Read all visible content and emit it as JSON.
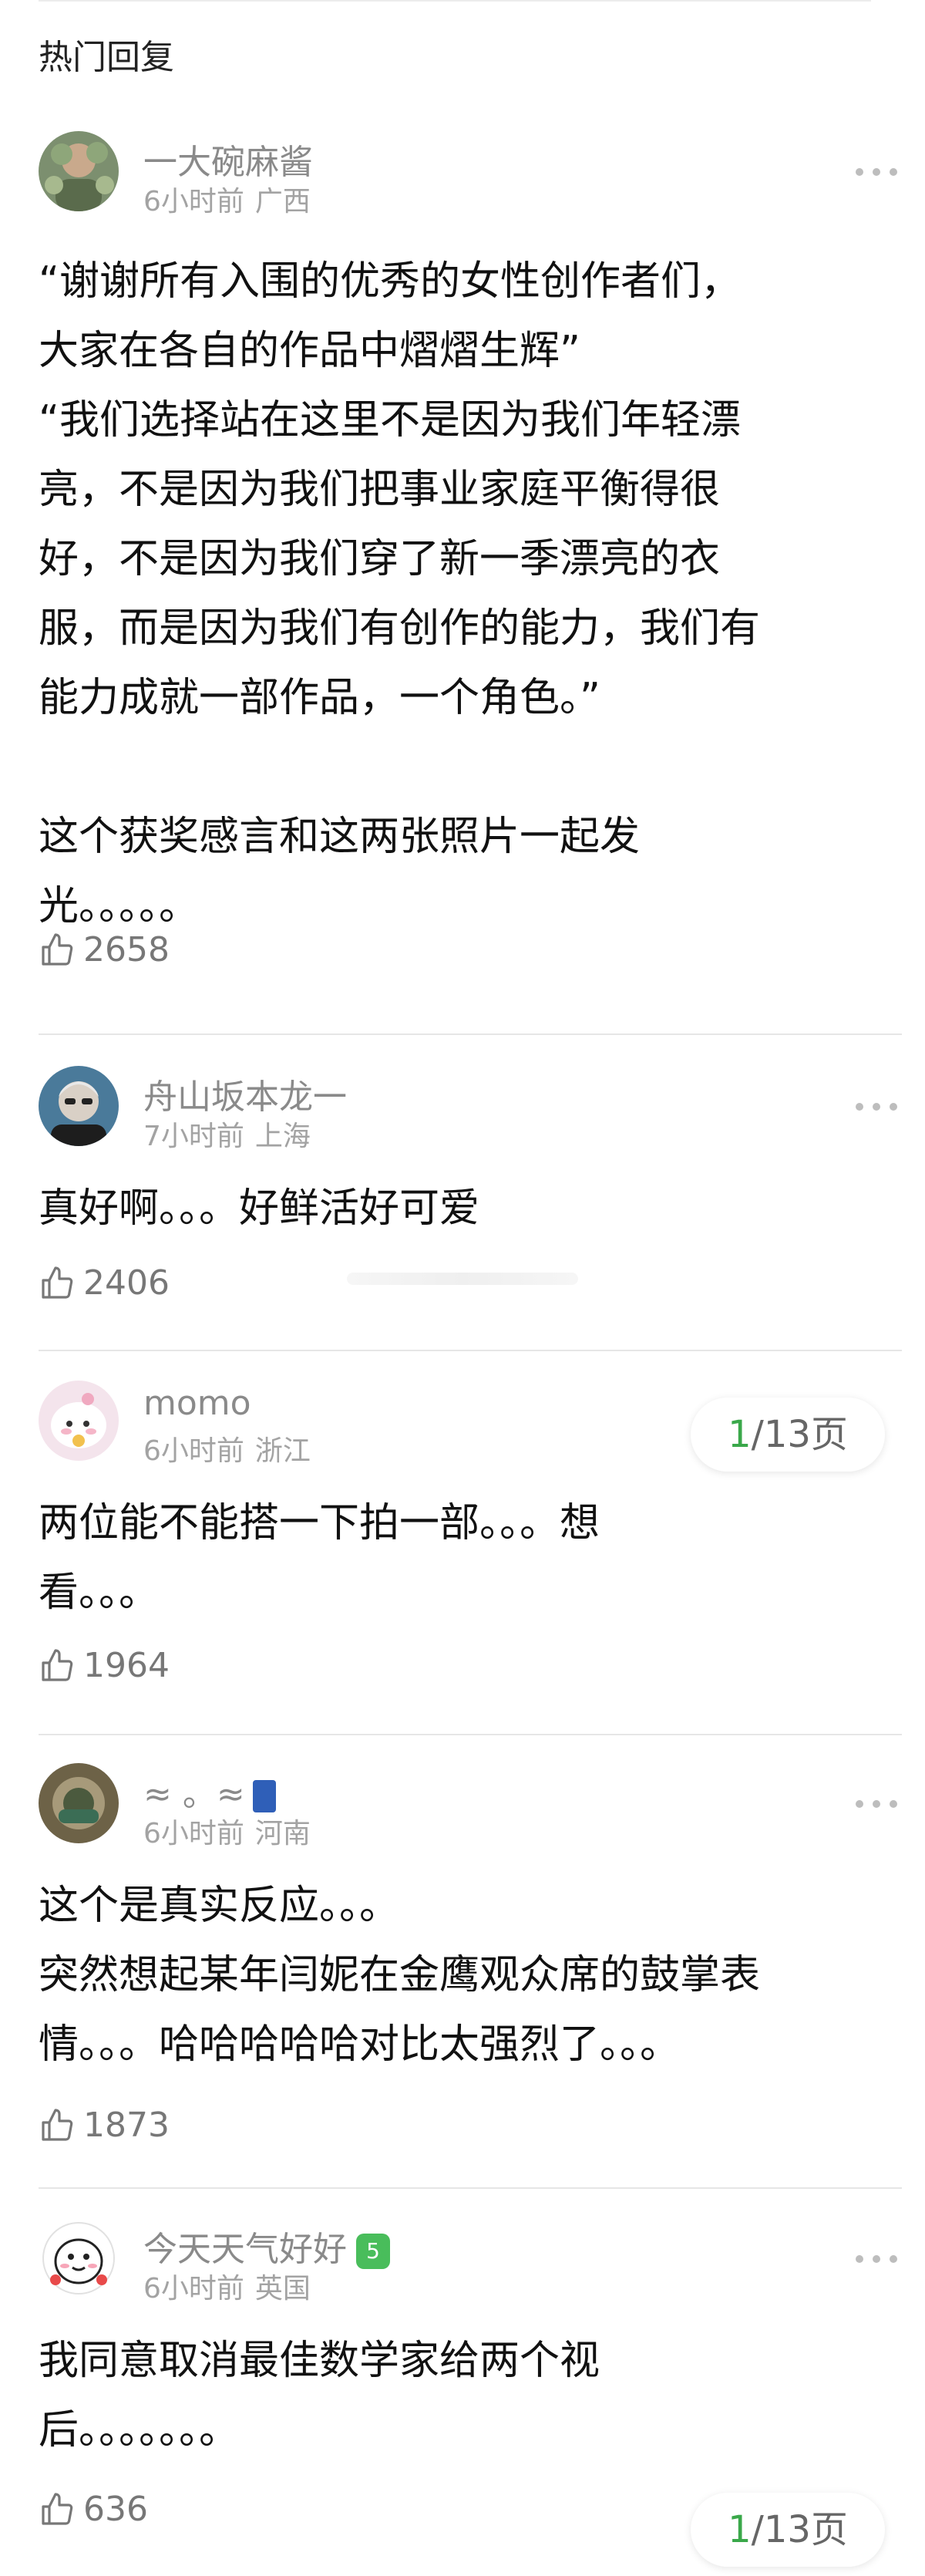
{
  "section_title": "热门回复",
  "like_icon": "thumbs-up-icon",
  "more_icon": "more-dots-icon",
  "comments": [
    {
      "username": "一大碗麻酱",
      "time": "6小时前",
      "location": "广西",
      "text": "“谢谢所有入围的优秀的女性创作者们，\n大家在各自的作品中熠熠生辉”\n“我们选择站在这里不是因为我们年轻漂\n亮，不是因为我们把事业家庭平衡得很\n好，不是因为我们穿了新一季漂亮的衣\n服，而是因为我们有创作的能力，我们有\n能力成就一部作品，一个角色。”\n\n这个获奖感言和这两张照片一起发\n光。。。。。",
      "likes": "2658"
    },
    {
      "username": "舟山坂本龙一",
      "time": "7小时前",
      "location": "上海",
      "text": "真好啊。。。好鲜活好可爱",
      "likes": "2406"
    },
    {
      "username": "momo",
      "time": "6小时前",
      "location": "浙江",
      "text": "两位能不能搭一下拍一部。。。想\n看。。。",
      "likes": "1964"
    },
    {
      "username": "≈  。≈",
      "time": "6小时前",
      "location": "河南",
      "text": "这个是真实反应。。。\n突然想起某年闫妮在金鹰观众席的鼓掌表\n情。。。哈哈哈哈哈对比太强烈了。。。",
      "likes": "1873"
    },
    {
      "username": "今天天气好好",
      "badge": "5",
      "time": "6小时前",
      "location": "英国",
      "text": "我同意取消最佳数学家给两个视\n后。。。。。。。",
      "likes": "636"
    }
  ],
  "pager": {
    "current": "1",
    "rest": "/13页"
  },
  "colors": {
    "accent_green": "#3aa84a",
    "badge_green": "#49bd5b",
    "meta_gray": "#a3a3a3"
  }
}
